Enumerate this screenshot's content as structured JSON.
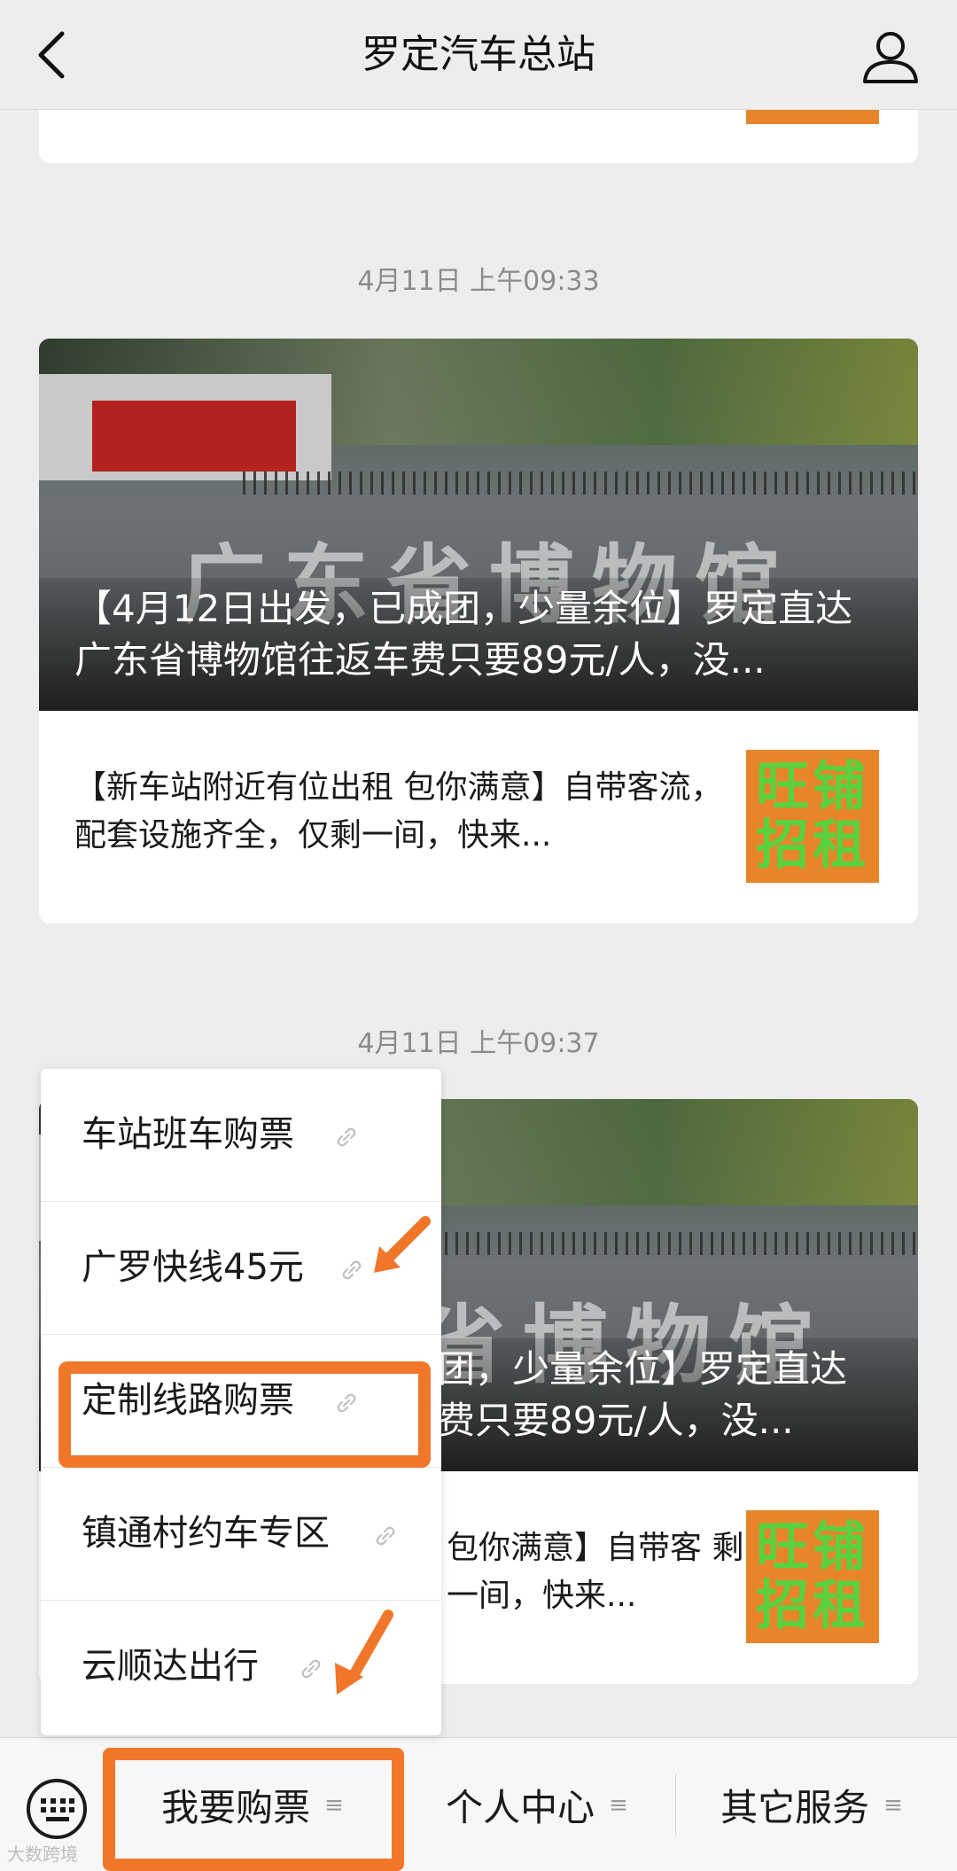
{
  "header": {
    "title": "罗定汽车总站"
  },
  "feed": [
    {
      "timestamp": "4月11日 上午09:33",
      "hero_watermark": "广东省博物馆",
      "hero_caption": "【4月12日出发，已成团，少量余位】罗定直达广东省博物馆往返车费只要89元/人，没...",
      "sub_text": "【新车站附近有位出租  包你满意】自带客流，配套设施齐全，仅剩一间，快来...",
      "ad_text_1": "旺铺",
      "ad_text_2": "招租"
    },
    {
      "timestamp": "4月11日 上午09:37",
      "hero_watermark": "省博物馆",
      "hero_caption": "团，少量余位】罗定直达 费只要89元/人，没...",
      "sub_text": "包你满意】自带客 剩一间，快来...",
      "ad_text_1": "旺铺",
      "ad_text_2": "招租"
    }
  ],
  "menu": {
    "items": [
      {
        "label": "车站班车购票"
      },
      {
        "label": "广罗快线45元"
      },
      {
        "label": "定制线路购票"
      },
      {
        "label": "镇通村约车专区"
      },
      {
        "label": "云顺达出行"
      }
    ]
  },
  "tabs": [
    {
      "label": "我要购票"
    },
    {
      "label": "个人中心"
    },
    {
      "label": "其它服务"
    }
  ],
  "footer_watermark": "大数跨境",
  "colors": {
    "highlight": "#f0772a",
    "ad_bg": "#e8852a",
    "ad_text": "#5ad23f"
  }
}
